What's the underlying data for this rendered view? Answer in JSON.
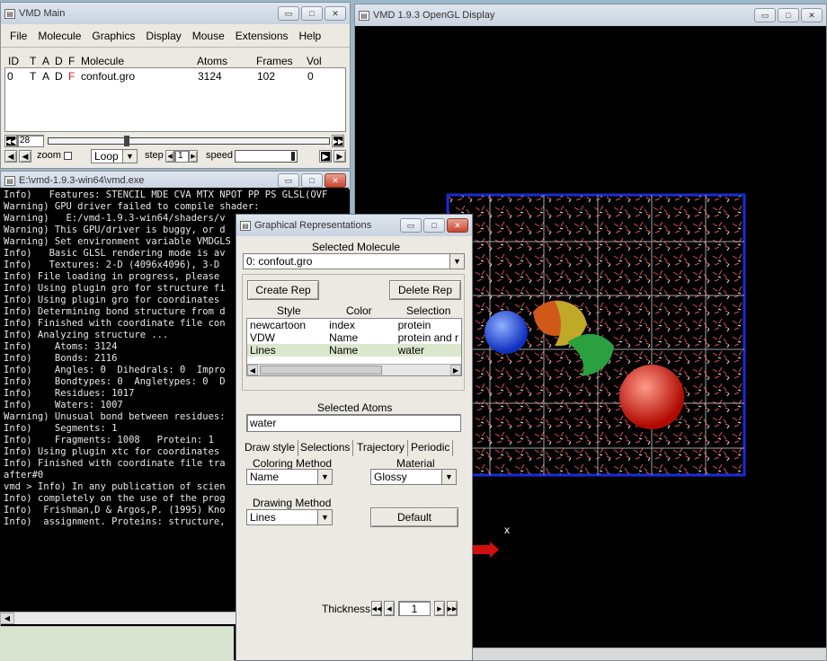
{
  "vmd_main": {
    "title": "VMD Main",
    "menu": [
      "File",
      "Molecule",
      "Graphics",
      "Display",
      "Mouse",
      "Extensions",
      "Help"
    ],
    "headers": {
      "id": "ID",
      "t": "T",
      "a": "A",
      "d": "D",
      "f": "F",
      "molecule": "Molecule",
      "atoms": "Atoms",
      "frames": "Frames",
      "vol": "Vol"
    },
    "row": {
      "id": "0",
      "t": "T",
      "a": "A",
      "d": "D",
      "f": "F",
      "molecule": "confout.gro",
      "atoms": "3124",
      "frames": "102",
      "vol": "0"
    },
    "frame_value": "28",
    "zoom_label": "zoom",
    "loop_value": "Loop",
    "step_label": "step",
    "step_value": "1",
    "speed_label": "speed"
  },
  "display_window": {
    "title": "VMD 1.9.3 OpenGL Display",
    "axis_label": "x"
  },
  "console_window": {
    "title": "E:\\vmd-1.9.3-win64\\vmd.exe",
    "lines": [
      "Info)   Features: STENCIL MDE CVA MTX NPOT PP PS GLSL(OVF",
      "Warning) GPU driver failed to compile shader:",
      "Warning)   E:/vmd-1.9.3-win64/shaders/v",
      "Warning) This GPU/driver is buggy, or d",
      "Warning) Set environment variable VMDGLS",
      "Info)   Basic GLSL rendering mode is av",
      "Info)   Textures: 2-D (4096x4096), 3-D",
      "Info) File loading in progress, please",
      "Info) Using plugin gro for structure fi",
      "Info) Using plugin gro for coordinates",
      "Info) Determining bond structure from d",
      "Info) Finished with coordinate file con",
      "Info) Analyzing structure ...",
      "Info)    Atoms: 3124",
      "Info)    Bonds: 2116",
      "Info)    Angles: 0  Dihedrals: 0  Impro",
      "Info)    Bondtypes: 0  Angletypes: 0  D",
      "Info)    Residues: 1017",
      "Info)    Waters: 1007",
      "Warning) Unusual bond between residues:",
      "Info)    Segments: 1",
      "Info)    Fragments: 1008   Protein: 1",
      "Info) Using plugin xtc for coordinates",
      "Info) Finished with coordinate file tra",
      "after#0",
      "vmd > Info) In any publication of scien",
      "Info) completely on the use of the prog",
      "Info)  Frishman,D & Argos,P. (1995) Kno",
      "Info)  assignment. Proteins: structure,"
    ]
  },
  "graph_reps": {
    "title": "Graphical Representations",
    "selected_molecule_label": "Selected Molecule",
    "selected_molecule_value": "0: confout.gro",
    "create_rep": "Create Rep",
    "delete_rep": "Delete Rep",
    "columns": {
      "style": "Style",
      "color": "Color",
      "selection": "Selection"
    },
    "reps": [
      {
        "style": "newcartoon",
        "color": "index",
        "selection": "protein"
      },
      {
        "style": "VDW",
        "color": "Name",
        "selection": "protein and r"
      },
      {
        "style": "Lines",
        "color": "Name",
        "selection": "water"
      }
    ],
    "selected_atoms_label": "Selected Atoms",
    "selected_atoms_value": "water",
    "tabs": [
      "Draw style",
      "Selections",
      "Trajectory",
      "Periodic"
    ],
    "coloring_method_label": "Coloring Method",
    "coloring_method_value": "Name",
    "material_label": "Material",
    "material_value": "Glossy",
    "drawing_method_label": "Drawing Method",
    "drawing_method_value": "Lines",
    "default_button": "Default",
    "thickness_label": "Thickness",
    "thickness_value": "1"
  }
}
